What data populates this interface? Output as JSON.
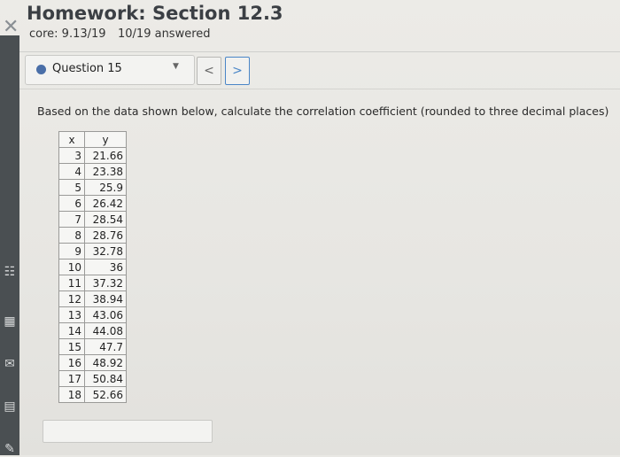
{
  "header": {
    "title": "Homework: Section 12.3",
    "score": "core: 9.13/19",
    "answered": "10/19 answered"
  },
  "question": {
    "label": "Question 15",
    "prev": "<",
    "next": ">",
    "prompt": "Based on the data shown below, calculate the correlation coefficient (rounded to three decimal places)"
  },
  "table": {
    "headers": [
      "x",
      "y"
    ],
    "rows": [
      [
        "3",
        "21.66"
      ],
      [
        "4",
        "23.38"
      ],
      [
        "5",
        "25.9"
      ],
      [
        "6",
        "26.42"
      ],
      [
        "7",
        "28.54"
      ],
      [
        "8",
        "28.76"
      ],
      [
        "9",
        "32.78"
      ],
      [
        "10",
        "36"
      ],
      [
        "11",
        "37.32"
      ],
      [
        "12",
        "38.94"
      ],
      [
        "13",
        "43.06"
      ],
      [
        "14",
        "44.08"
      ],
      [
        "15",
        "47.7"
      ],
      [
        "16",
        "48.92"
      ],
      [
        "17",
        "50.84"
      ],
      [
        "18",
        "52.66"
      ]
    ]
  },
  "answer": {
    "value": ""
  }
}
